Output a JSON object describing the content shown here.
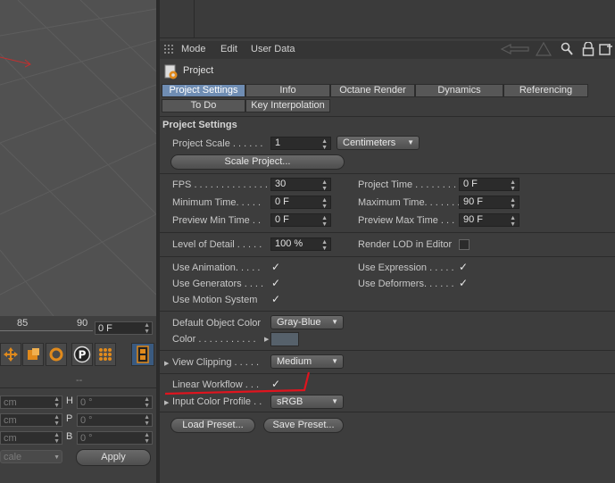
{
  "timeline": {
    "tick_85": "85",
    "tick_90": "90",
    "frame_field": "0 F"
  },
  "coords": {
    "header": "--",
    "rows": [
      {
        "left_value": "cm",
        "axis": "H",
        "right_value": "0 °"
      },
      {
        "left_value": "cm",
        "axis": "P",
        "right_value": "0 °"
      },
      {
        "left_value": "cm",
        "axis": "B",
        "right_value": "0 °"
      }
    ],
    "scale_dropdown": "cale",
    "apply_label": "Apply"
  },
  "menu": {
    "items": [
      "Mode",
      "Edit",
      "User Data"
    ]
  },
  "object": {
    "name": "Project"
  },
  "tabs": {
    "row1": [
      "Project Settings",
      "Info",
      "Octane Render",
      "Dynamics",
      "Referencing"
    ],
    "row2": [
      "To Do",
      "Key Interpolation"
    ],
    "active": "Project Settings"
  },
  "section": {
    "title": "Project Settings"
  },
  "settings": {
    "project_scale_label": "Project Scale . . . . . .",
    "project_scale_value": "1",
    "units_value": "Centimeters",
    "scale_project_button": "Scale Project...",
    "fps_label": "FPS . . . . . . . . . . . . . . .",
    "fps_value": "30",
    "project_time_label": "Project Time . . . . . . . .",
    "project_time_value": "0 F",
    "min_time_label": "Minimum Time. . . . .",
    "min_time_value": "0 F",
    "max_time_label": "Maximum Time. . . . . . .",
    "max_time_value": "90 F",
    "preview_min_label": "Preview Min Time . .",
    "preview_min_value": "0 F",
    "preview_max_label": "Preview Max Time . . .",
    "preview_max_value": "90 F",
    "lod_label": "Level of Detail . . . . .",
    "lod_value": "100 %",
    "render_lod_label": "Render LOD in Editor",
    "use_animation_label": "Use Animation. . . . .",
    "use_expression_label": "Use Expression . . . . .",
    "use_generators_label": "Use Generators . . . .",
    "use_deformers_label": "Use Deformers. . . . . .",
    "use_motion_label": "Use Motion System",
    "default_color_label": "Default Object Color",
    "default_color_value": "Gray-Blue",
    "color_label": "Color . . . . . . . . . . .",
    "view_clipping_label": "View Clipping . . . . .",
    "view_clipping_value": "Medium",
    "linear_workflow_label": "Linear Workflow . . .",
    "input_profile_label": "Input Color Profile . .",
    "input_profile_value": "sRGB",
    "load_preset": "Load Preset...",
    "save_preset": "Save Preset..."
  },
  "colors": {
    "active_tab": "#6f8db3",
    "annotation": "#e0141e",
    "swatch": "#56616b"
  }
}
